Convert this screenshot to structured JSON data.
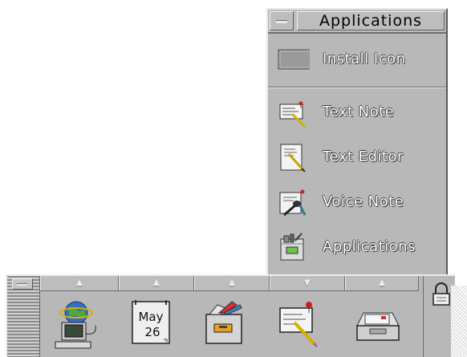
{
  "subpanel": {
    "title": "Applications",
    "items": [
      {
        "label": "Install Icon",
        "icon": "install-icon-dropzone"
      },
      {
        "label": "Text Note",
        "icon": "text-note-icon"
      },
      {
        "label": "Text Editor",
        "icon": "text-editor-icon"
      },
      {
        "label": "Voice Note",
        "icon": "voice-note-icon"
      },
      {
        "label": "Applications",
        "icon": "applications-folder-icon"
      }
    ]
  },
  "front_panel": {
    "arrows": [
      "up",
      "up",
      "up",
      "down",
      "up"
    ],
    "calendar": {
      "month": "May",
      "day": "26"
    },
    "launchers": [
      "globe-computer-icon",
      "calendar-icon",
      "file-manager-icon",
      "text-note-icon",
      "mail-tray-icon"
    ],
    "lock_icon": "padlock-icon"
  }
}
